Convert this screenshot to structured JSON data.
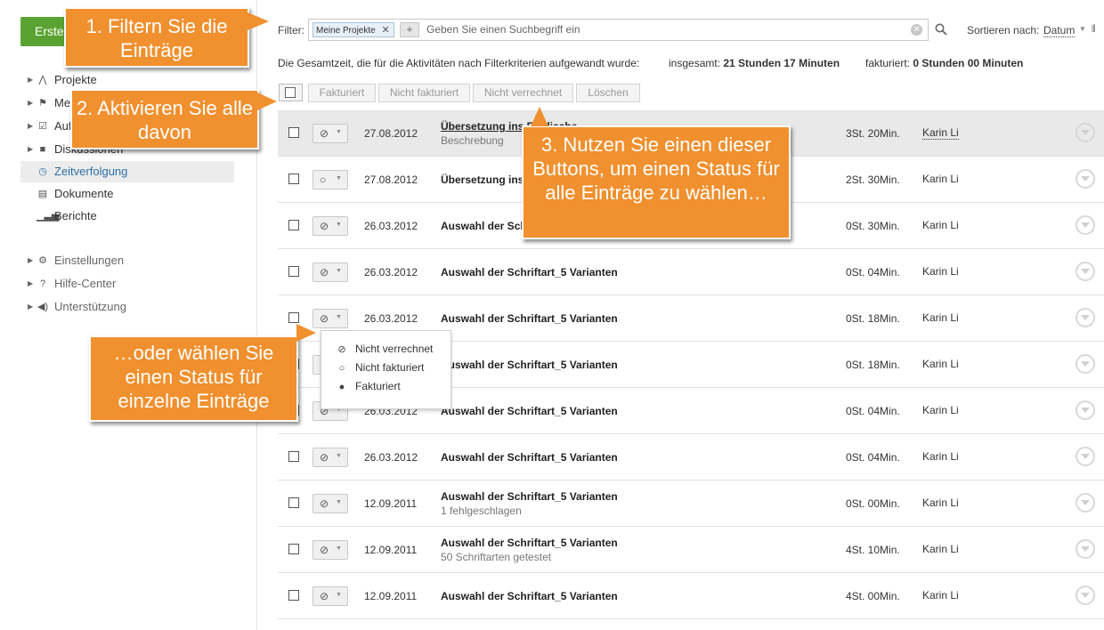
{
  "sidebar": {
    "create_button": "Erstellen",
    "items": [
      {
        "label": "Projekte",
        "icon": "projects-icon"
      },
      {
        "label": "Meilensteine",
        "icon": "flag-icon"
      },
      {
        "label": "Aufgaben",
        "icon": "task-check-icon"
      },
      {
        "label": "Diskussionen",
        "icon": "discussion-icon"
      },
      {
        "label": "Zeitverfolgung",
        "icon": "clock-icon",
        "active": true
      },
      {
        "label": "Dokumente",
        "icon": "document-icon"
      },
      {
        "label": "Berichte",
        "icon": "bar-chart-icon"
      }
    ],
    "secondary": [
      {
        "label": "Einstellungen",
        "icon": "gear-icon"
      },
      {
        "label": "Hilfe-Center",
        "icon": "help-icon"
      },
      {
        "label": "Unterstützung",
        "icon": "megaphone-icon"
      }
    ]
  },
  "filter": {
    "label": "Filter:",
    "chip": "Meine Projekte",
    "placeholder": "Geben Sie einen Suchbegriff ein",
    "sort_label": "Sortieren nach:",
    "sort_value": "Datum"
  },
  "summary": {
    "text": "Die Gesamtzeit, die für die Aktivitäten nach Filterkriterien aufgewandt wurde:",
    "total_label": "insgesamt:",
    "total_value": "21 Stunden 17 Minuten",
    "billed_label": "fakturiert:",
    "billed_value": "0 Stunden 00 Minuten"
  },
  "bulk_actions": [
    "Fakturiert",
    "Nicht fakturiert",
    "Nicht verrechnet",
    "Löschen"
  ],
  "rows": [
    {
      "status": "not-billable",
      "date": "27.08.2012",
      "title": "Übersetzung ins Englische",
      "subtitle": "Beschrebung",
      "duration": "3St. 20Min.",
      "user": "Karin Li"
    },
    {
      "status": "not-billed",
      "date": "27.08.2012",
      "title": "Übersetzung ins Englische",
      "subtitle": "",
      "duration": "2St. 30Min.",
      "user": "Karin Li"
    },
    {
      "status": "not-billable",
      "date": "26.03.2012",
      "title": "Auswahl der Schriftart_5 Varianten",
      "subtitle": "",
      "duration": "0St. 30Min.",
      "user": "Karin Li"
    },
    {
      "status": "not-billable",
      "date": "26.03.2012",
      "title": "Auswahl der Schriftart_5 Varianten",
      "subtitle": "",
      "duration": "0St. 04Min.",
      "user": "Karin Li"
    },
    {
      "status": "not-billable",
      "date": "26.03.2012",
      "title": "Auswahl der Schriftart_5 Varianten",
      "subtitle": "",
      "duration": "0St. 18Min.",
      "user": "Karin Li"
    },
    {
      "status": "not-billable",
      "date": "26.03.2012",
      "title": "Auswahl der Schriftart_5 Varianten",
      "subtitle": "",
      "duration": "0St. 18Min.",
      "user": "Karin Li"
    },
    {
      "status": "not-billable",
      "date": "26.03.2012",
      "title": "Auswahl der Schriftart_5 Varianten",
      "subtitle": "",
      "duration": "0St. 04Min.",
      "user": "Karin Li"
    },
    {
      "status": "not-billable",
      "date": "26.03.2012",
      "title": "Auswahl der Schriftart_5 Varianten",
      "subtitle": "",
      "duration": "0St. 04Min.",
      "user": "Karin Li"
    },
    {
      "status": "not-billable",
      "date": "12.09.2011",
      "title": "Auswahl der Schriftart_5 Varianten",
      "subtitle": "1 fehlgeschlagen",
      "duration": "0St. 00Min.",
      "user": "Karin Li"
    },
    {
      "status": "not-billable",
      "date": "12.09.2011",
      "title": "Auswahl der Schriftart_5 Varianten",
      "subtitle": "50 Schriftarten getestet",
      "duration": "4St. 10Min.",
      "user": "Karin Li"
    },
    {
      "status": "not-billable",
      "date": "12.09.2011",
      "title": "Auswahl der Schriftart_5 Varianten",
      "subtitle": "",
      "duration": "4St. 00Min.",
      "user": "Karin Li"
    }
  ],
  "status_menu": [
    {
      "label": "Nicht verrechnet",
      "icon": "not-billable-icon"
    },
    {
      "label": "Nicht fakturiert",
      "icon": "not-billed-icon"
    },
    {
      "label": "Fakturiert",
      "icon": "billed-icon"
    }
  ],
  "callouts": [
    "1. Filtern Sie die Einträge",
    "2. Aktivieren Sie alle davon",
    "3. Nutzen Sie einen dieser Buttons, um einen Status für alle Einträge zu wählen…",
    "…oder wählen Sie einen Status für einzelne Einträge"
  ],
  "colors": {
    "accent": "#f0902e",
    "create": "#5aa231",
    "active_link": "#2a6fa8"
  }
}
